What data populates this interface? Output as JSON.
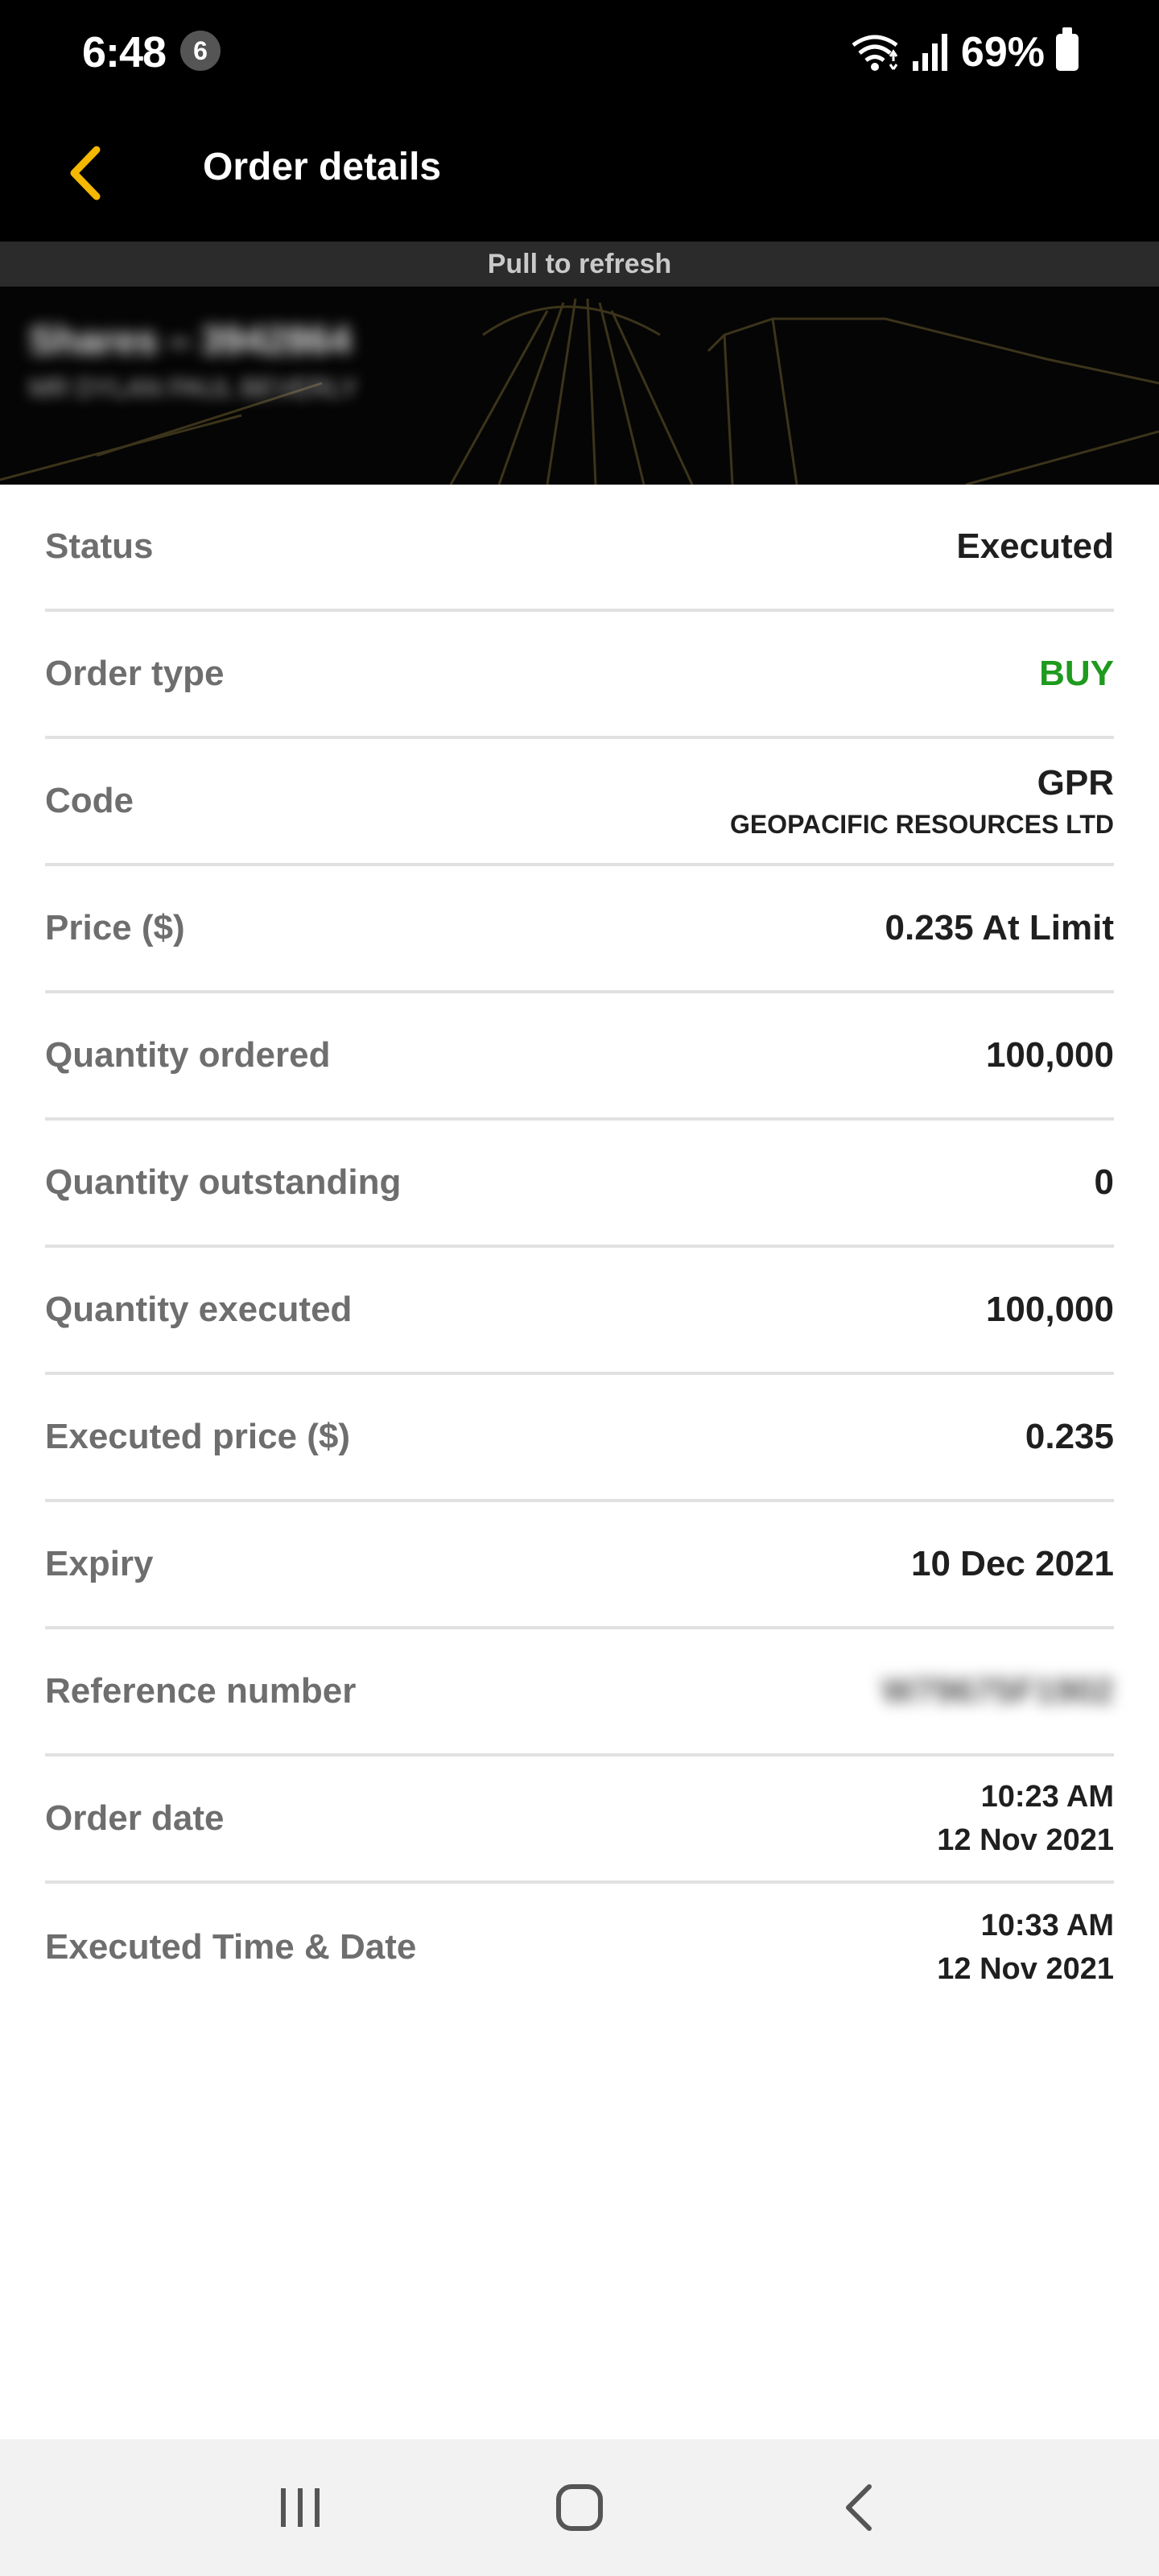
{
  "status_bar": {
    "time": "6:48",
    "notification_count": "6",
    "battery": "69%",
    "icons": [
      "wifi-icon",
      "signal-icon",
      "battery-icon"
    ]
  },
  "header": {
    "title": "Order details",
    "back_icon": "chevron-left-icon",
    "accent_color": "#f5b800"
  },
  "refresh": {
    "label": "Pull to refresh"
  },
  "account": {
    "name": "Shares – 3942864",
    "sub": "MR DYLAN PAUL BEVERLY"
  },
  "details": {
    "status": {
      "label": "Status",
      "value": "Executed"
    },
    "order_type": {
      "label": "Order type",
      "value": "BUY",
      "color": "#1e9a1e"
    },
    "code": {
      "label": "Code",
      "value": "GPR",
      "company": "GEOPACIFIC RESOURCES LTD"
    },
    "price": {
      "label": "Price ($)",
      "value": "0.235 At Limit"
    },
    "quantity_ordered": {
      "label": "Quantity ordered",
      "value": "100,000"
    },
    "quantity_outstanding": {
      "label": "Quantity outstanding",
      "value": "0"
    },
    "quantity_executed": {
      "label": "Quantity executed",
      "value": "100,000"
    },
    "executed_price": {
      "label": "Executed price ($)",
      "value": "0.235"
    },
    "expiry": {
      "label": "Expiry",
      "value": "10 Dec 2021"
    },
    "reference_number": {
      "label": "Reference number",
      "value": "W79675F1902"
    },
    "order_date": {
      "label": "Order date",
      "time": "10:23 AM",
      "date": "12 Nov 2021"
    },
    "executed_time_date": {
      "label": "Executed Time & Date",
      "time": "10:33 AM",
      "date": "12 Nov 2021"
    }
  },
  "nav_bar": {
    "icons": [
      "recent-apps-icon",
      "home-icon",
      "back-icon"
    ]
  }
}
